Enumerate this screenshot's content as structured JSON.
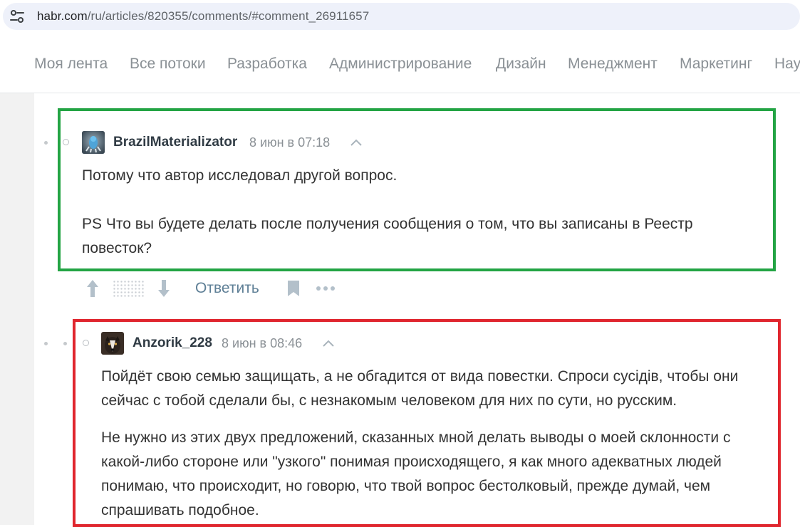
{
  "browser": {
    "url_host": "habr.com",
    "url_path": "/ru/articles/820355/comments/#comment_26911657"
  },
  "nav": {
    "items": [
      {
        "label": "Моя лента"
      },
      {
        "label": "Все потоки"
      },
      {
        "label": "Разработка"
      },
      {
        "label": "Администрирование"
      },
      {
        "label": "Дизайн"
      },
      {
        "label": "Менеджмент"
      },
      {
        "label": "Маркетинг"
      },
      {
        "label": "Нау"
      }
    ]
  },
  "comments": [
    {
      "author": "BrazilMaterializator",
      "time": "8 июн в 07:18",
      "paragraphs": [
        "Потому что автор исследовал другой вопрос.",
        "PS Что вы будете делать после получения сообщения о том, что вы записаны в Реестр повесток?"
      ],
      "actions": {
        "reply_label": "Ответить"
      },
      "highlight_color": "#23a444"
    },
    {
      "author": "Anzorik_228",
      "time": "8 июн в 08:46",
      "paragraphs": [
        "Пойдёт свою семью защищать, а не обгадится от вида повестки. Спроси сусідів, чтобы они сейчас с тобой сделали бы, с незнакомым человеком для них по сути, но русским.",
        "Не нужно из этих двух предложений, сказанных мной делать выводы о моей склонности с какой-либо стороне или \"узкого\" понимая происходящего, я как много адекватных людей понимаю, что происходит, но говорю, что твой вопрос бестолковый, прежде думай, чем спрашивать подобное."
      ],
      "highlight_color": "#e0262e"
    }
  ]
}
